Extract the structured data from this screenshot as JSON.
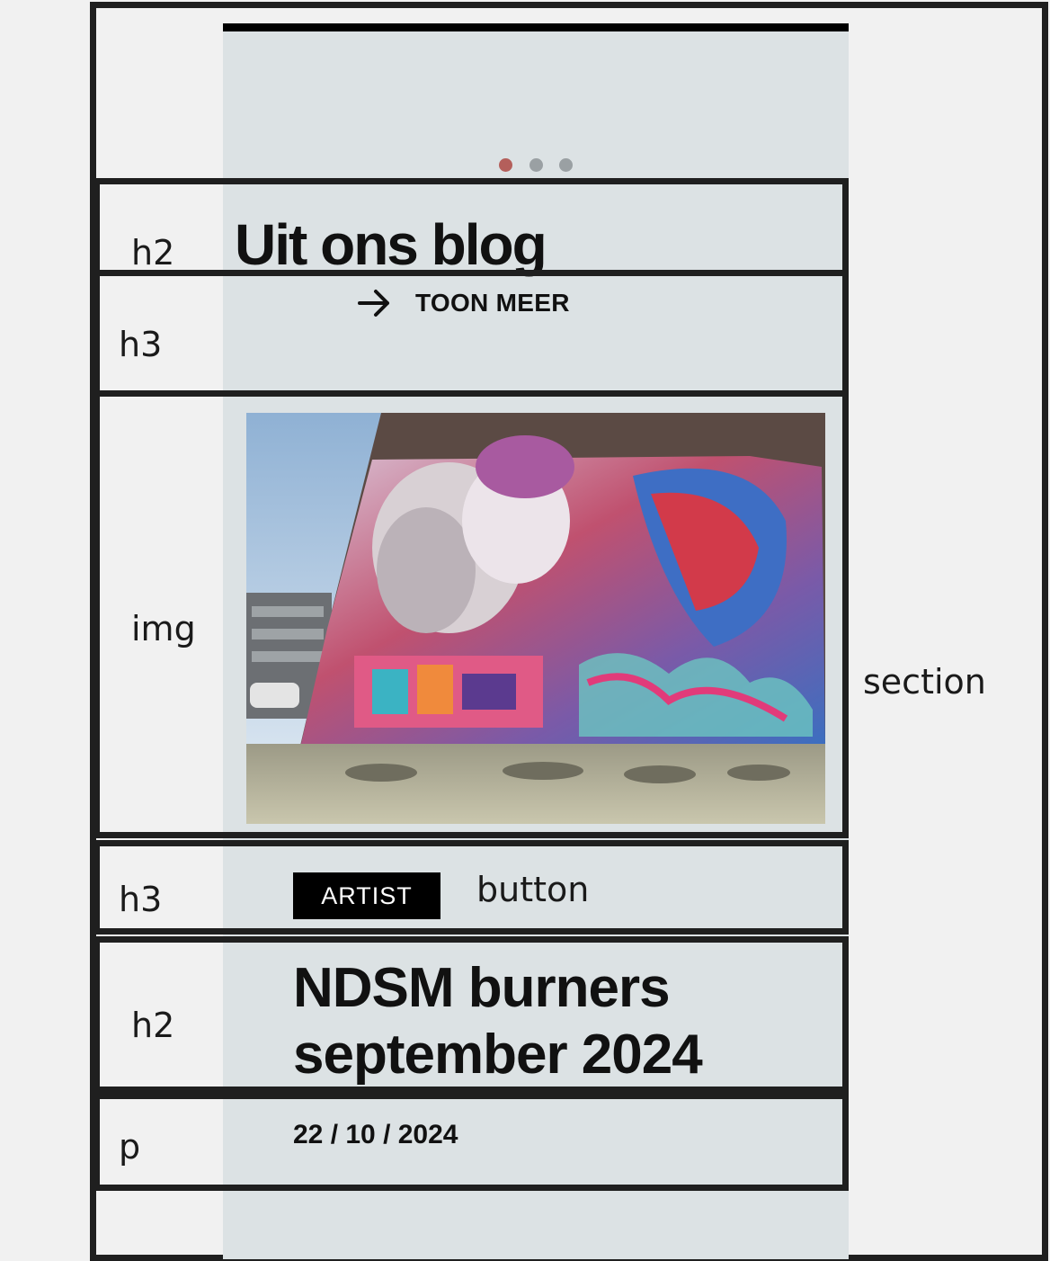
{
  "carousel": {
    "dots": [
      {
        "state": "active",
        "color": "#b45f5b"
      },
      {
        "state": "inactive",
        "color": "#9aa0a3"
      },
      {
        "state": "inactive",
        "color": "#9aa0a3"
      }
    ]
  },
  "labels": {
    "h2_title": "h2",
    "h3_link": "h3",
    "img": "img",
    "section": "section",
    "h3_badge": "h3",
    "button": "button",
    "h2_post": "h2",
    "p_date": "p"
  },
  "blog": {
    "title": "Uit ons blog",
    "more_link": "TOON MEER",
    "post": {
      "category": "ARTIST",
      "title": "NDSM burners september 2024",
      "date": "22 / 10 / 2024",
      "image_subject": "graffiti mural of embracing classical figures on a brick wall"
    }
  },
  "colors": {
    "page_background": "#dce2e4",
    "canvas": "#f1f1f1",
    "annotation_border": "#1f1f1f",
    "badge": "#000000"
  }
}
